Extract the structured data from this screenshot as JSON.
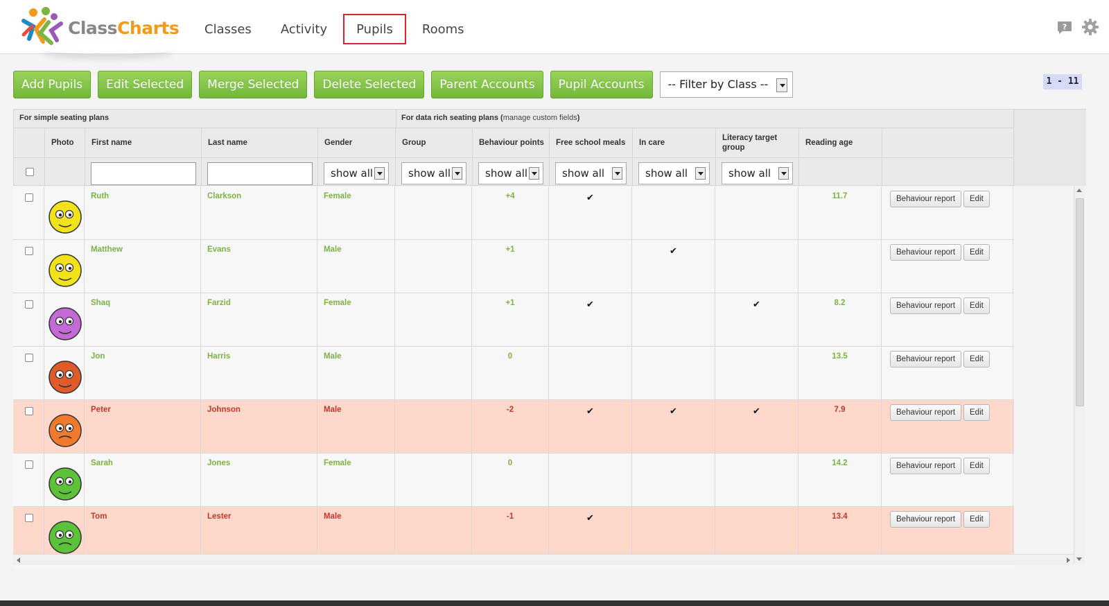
{
  "brand": {
    "part1": "Class",
    "part2": "Charts"
  },
  "nav": [
    "Classes",
    "Activity",
    "Pupils",
    "Rooms"
  ],
  "toolbar": {
    "buttons": [
      "Add Pupils",
      "Edit Selected",
      "Merge Selected",
      "Delete Selected",
      "Parent Accounts",
      "Pupil Accounts"
    ],
    "filter_label": "-- Filter by Class --"
  },
  "pager": "1 - 11",
  "sections": {
    "simple": "For simple seating plans",
    "rich": "For data rich seating plans",
    "rich_link": "manage custom fields"
  },
  "columns": [
    "Photo",
    "First name",
    "Last name",
    "Gender",
    "Group",
    "Behaviour points",
    "Free school meals",
    "In care",
    "Literacy target group",
    "Reading age"
  ],
  "filter_option": "show all",
  "row_buttons": {
    "report": "Behaviour report",
    "edit": "Edit"
  },
  "tick": "✔",
  "rows": [
    {
      "first": "Ruth",
      "last": "Clarkson",
      "gender": "Female",
      "points": "+4",
      "fsm": "✔",
      "care": "",
      "lit": "",
      "reading": "11.7"
    },
    {
      "first": "Matthew",
      "last": "Evans",
      "gender": "Male",
      "points": "+1",
      "fsm": "",
      "care": "✔",
      "lit": "",
      "reading": ""
    },
    {
      "first": "Shaq",
      "last": "Farzid",
      "gender": "Female",
      "points": "+1",
      "fsm": "✔",
      "care": "",
      "lit": "✔",
      "reading": "8.2"
    },
    {
      "first": "Jon",
      "last": "Harris",
      "gender": "Male",
      "points": "0",
      "fsm": "",
      "care": "",
      "lit": "",
      "reading": "13.5"
    },
    {
      "first": "Peter",
      "last": "Johnson",
      "gender": "Male",
      "points": "-2",
      "fsm": "✔",
      "care": "✔",
      "lit": "✔",
      "reading": "7.9"
    },
    {
      "first": "Sarah",
      "last": "Jones",
      "gender": "Female",
      "points": "0",
      "fsm": "",
      "care": "",
      "lit": "",
      "reading": "14.2"
    },
    {
      "first": "Tom",
      "last": "Lester",
      "gender": "Male",
      "points": "-1",
      "fsm": "✔",
      "care": "",
      "lit": "",
      "reading": "13.4"
    }
  ],
  "colors": {
    "accent_green": "#7cb342",
    "negative_red": "#c0392b",
    "active_nav_border": "#d9232d",
    "negative_row": "#fed9cb"
  },
  "icons": [
    "help-icon",
    "gear-icon",
    "checkbox",
    "dropdown-arrow-icon",
    "pupil-avatar-icon"
  ]
}
